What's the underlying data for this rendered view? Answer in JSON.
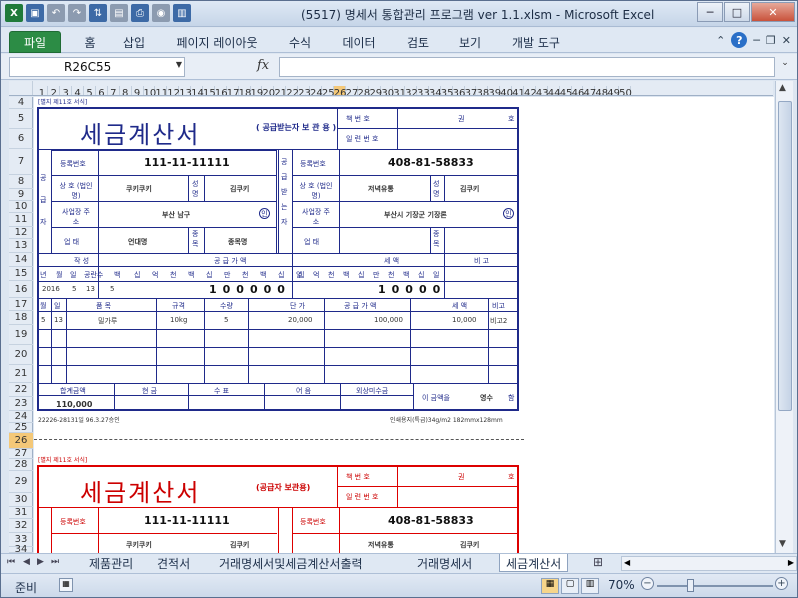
{
  "window": {
    "title": "(5517) 명세서 통합관리 프로그램 ver 1.1.xlsm - Microsoft Excel",
    "min": "─",
    "max": "□",
    "close": "✕"
  },
  "qat": {
    "icons": [
      "excel-logo-icon",
      "save-icon",
      "undo-icon",
      "redo-icon",
      "sort-icon",
      "form-icon",
      "print-icon",
      "camera-icon",
      "chart-icon"
    ]
  },
  "ribbon": {
    "tabs": [
      "파일",
      "홈",
      "삽입",
      "페이지 레이아웃",
      "수식",
      "데이터",
      "검토",
      "보기",
      "개발 도구"
    ],
    "help": "?"
  },
  "formula_bar": {
    "name_box": "R26C55",
    "fx": "fx",
    "value": ""
  },
  "columns": [
    "1",
    "2",
    "3",
    "4",
    "5",
    "6",
    "7",
    "8",
    "9",
    "10",
    "11",
    "12",
    "13",
    "14",
    "15",
    "16",
    "17",
    "18",
    "19",
    "20",
    "21",
    "22",
    "23",
    "24",
    "25",
    "26",
    "27",
    "28",
    "29",
    "30",
    "31",
    "32",
    "33",
    "34",
    "35",
    "36",
    "37",
    "38",
    "39",
    "40",
    "41",
    "42",
    "43",
    "44",
    "45",
    "46",
    "47",
    "48",
    "49",
    "50"
  ],
  "rows": [
    "4",
    "5",
    "6",
    "7",
    "8",
    "9",
    "10",
    "11",
    "12",
    "13",
    "14",
    "15",
    "16",
    "17",
    "18",
    "19",
    "20",
    "21",
    "22",
    "23",
    "24",
    "25",
    "26",
    "27",
    "28",
    "29",
    "30",
    "31",
    "32",
    "33",
    "34"
  ],
  "invoice_blue": {
    "form_label": "[별지 제11호 서식]",
    "title": "세금계산서",
    "subtitle": "( 공급받는자 보 관 용 )",
    "book_no": "책 번 호",
    "gwon": "권",
    "ho": "호",
    "serial": "일 련 번 호",
    "supplier_regno_label": "등록번호",
    "supplier_regno": "111-11-11111",
    "buyer_regno_label": "등록번호",
    "buyer_regno": "408-81-58833",
    "supplier_side": "공 급 자",
    "buyer_side": "공 급 받 는 자",
    "trade_name_label": "상 호 (법인명)",
    "supplier_name": "쿠키쿠키",
    "name_label": "성 명",
    "supplier_rep": "김쿠키",
    "buyer_name": "저녁유통",
    "buyer_rep": "김쿠키",
    "address_label": "사업장 주 소",
    "supplier_addr": "부산 남구",
    "buyer_addr": "부산시 기장군 기장론",
    "seal": "인",
    "biz_type_label": "업 태",
    "supplier_type": "언대명",
    "item_label": "종 목",
    "supplier_item": "종목명",
    "written": "작 성",
    "supply_amount": "공 급 가 액",
    "tax": "세 액",
    "remark": "비 고",
    "date_header": [
      "년",
      "월",
      "일",
      "공란수",
      "백",
      "십",
      "억",
      "천",
      "백",
      "십",
      "만",
      "천",
      "백",
      "십",
      "일"
    ],
    "year": "2016",
    "month": "5",
    "day": "13",
    "blank": "5",
    "supply_digits": "100000",
    "tax_digits": "10000",
    "item_cols": [
      "월",
      "일",
      "품 목",
      "규격",
      "수량",
      "단 가",
      "공 급 가 액",
      "세 액",
      "비고"
    ],
    "items": [
      {
        "m": "5",
        "d": "13",
        "name": "밀가루",
        "spec": "10kg",
        "qty": "5",
        "price": "20,000",
        "supply": "100,000",
        "tax": "10,000",
        "note": "비고2"
      }
    ],
    "total_label": "합계금액",
    "cash": "현 금",
    "check": "수 표",
    "bill": "어 음",
    "credit": "외상미수금",
    "total": "110,000",
    "receipt_prefix": "이 금액을",
    "receipt": "영수",
    "receipt_suffix": "함",
    "footer_left": "22226-28131일 96.3.27승인",
    "footer_right": "인쇄용지(특급)34g/m2 182mmx128mm"
  },
  "invoice_red": {
    "form_label": "[별지 제11호 서식]",
    "title": "세금계산서",
    "subtitle": "(공급자 보관용)",
    "book_no": "책 번 호",
    "gwon": "권",
    "ho": "호",
    "serial": "일 련 번 호",
    "supplier_regno_label": "등록번호",
    "supplier_regno": "111-11-11111",
    "buyer_regno_label": "등록번호",
    "buyer_regno": "408-81-58833",
    "supplier_name": "쿠키쿠키",
    "supplier_rep": "김쿠키",
    "buyer_name": "저녁유통",
    "buyer_rep": "김쿠키"
  },
  "sheet_tabs": [
    "제품관리",
    "견적서",
    "거래명세서및세금계산서출력",
    "거래명세서",
    "세금계산서"
  ],
  "active_tab": "세금계산서",
  "status": {
    "ready": "준비",
    "zoom": "70%"
  }
}
